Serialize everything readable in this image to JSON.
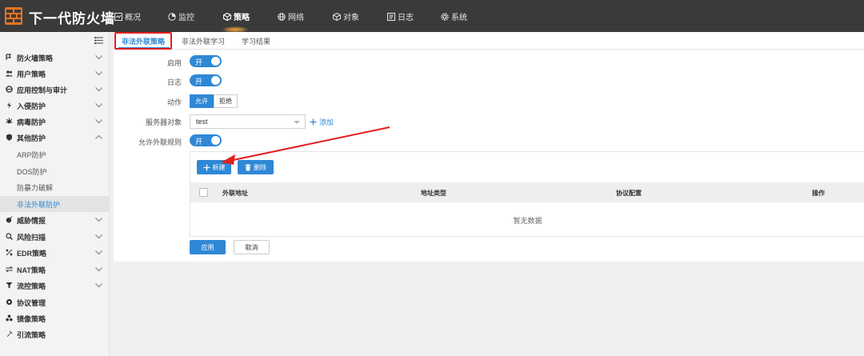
{
  "app": {
    "title": "下一代防火墙",
    "accent_color": "#2f88d6",
    "topbar_color": "#3a3a3a"
  },
  "topnav": [
    {
      "label": "概况",
      "icon": "overview-icon",
      "active": false
    },
    {
      "label": "监控",
      "icon": "monitor-icon",
      "active": false
    },
    {
      "label": "策略",
      "icon": "policy-icon",
      "active": true
    },
    {
      "label": "网络",
      "icon": "network-icon",
      "active": false
    },
    {
      "label": "对象",
      "icon": "object-icon",
      "active": false
    },
    {
      "label": "日志",
      "icon": "log-icon",
      "active": false
    },
    {
      "label": "系统",
      "icon": "system-icon",
      "active": false
    }
  ],
  "sidebar": {
    "groups": [
      {
        "label": "防火墙策略",
        "icon": "firewall-icon",
        "expanded": false
      },
      {
        "label": "用户策略",
        "icon": "users-icon",
        "expanded": false
      },
      {
        "label": "应用控制与审计",
        "icon": "app-control-icon",
        "expanded": false
      },
      {
        "label": "入侵防护",
        "icon": "intrusion-icon",
        "expanded": false
      },
      {
        "label": "病毒防护",
        "icon": "virus-icon",
        "expanded": false
      },
      {
        "label": "其他防护",
        "icon": "shield-icon",
        "expanded": true
      },
      {
        "label": "威胁情报",
        "icon": "threat-icon",
        "expanded": false
      },
      {
        "label": "风险扫描",
        "icon": "scan-icon",
        "expanded": false
      },
      {
        "label": "EDR策略",
        "icon": "edr-icon",
        "expanded": false
      },
      {
        "label": "NAT策略",
        "icon": "nat-icon",
        "expanded": false
      },
      {
        "label": "流控策略",
        "icon": "flow-control-icon",
        "expanded": false
      },
      {
        "label": "协议管理",
        "icon": "protocol-icon",
        "expanded": null
      },
      {
        "label": "镜像策略",
        "icon": "mirror-icon",
        "expanded": null
      },
      {
        "label": "引流策略",
        "icon": "diversion-icon",
        "expanded": null
      }
    ],
    "subitems": [
      {
        "label": "ARP防护",
        "selected": false
      },
      {
        "label": "DOS防护",
        "selected": false
      },
      {
        "label": "防暴力破解",
        "selected": false
      },
      {
        "label": "非法外联防护",
        "selected": true
      }
    ]
  },
  "tabs": [
    {
      "label": "非法外联策略",
      "active": true
    },
    {
      "label": "非法外联学习",
      "active": false
    },
    {
      "label": "学习结果",
      "active": false
    }
  ],
  "form": {
    "enable_label": "启用",
    "enable_value": "开",
    "log_label": "日志",
    "log_value": "开",
    "action_label": "动作",
    "action_options": [
      "允许",
      "拒绝"
    ],
    "action_selected": "允许",
    "server_label": "服务器对象",
    "server_value": "test",
    "add_label": "添加",
    "allow_rules_label": "允许外联规则",
    "allow_rules_value": "开"
  },
  "rules_table": {
    "new_button": "新建",
    "delete_button": "删除",
    "columns": [
      "外联地址",
      "地址类型",
      "协议配置",
      "操作"
    ],
    "rows": [],
    "empty_text": "暂无数据"
  },
  "footer": {
    "apply_button": "应用",
    "cancel_button": "取消"
  }
}
